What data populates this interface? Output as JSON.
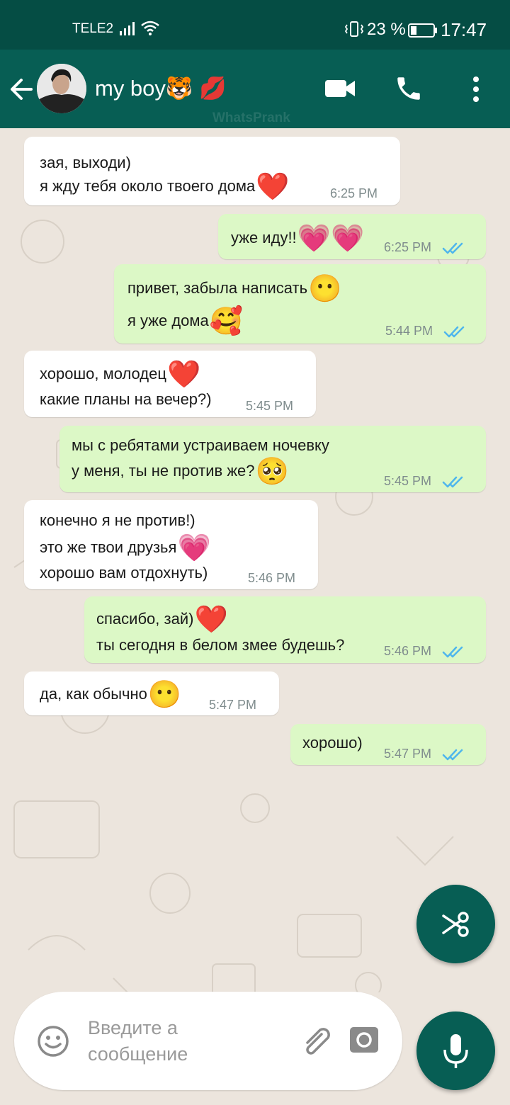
{
  "status_bar": {
    "carrier": "TELE2",
    "battery": "23 %",
    "time": "17:47"
  },
  "header": {
    "contact_name": "my boy🐯 💋",
    "watermark": "WhatsPrank"
  },
  "messages": [
    {
      "dir": "in",
      "lines": [
        "зая, выходи)",
        "я жду тебя около твоего дома"
      ],
      "emoji": [
        "",
        "❤️"
      ],
      "time": "6:25 PM"
    },
    {
      "dir": "out",
      "lines": [
        "уже иду!!"
      ],
      "emoji": [
        "💗💗"
      ],
      "time": "6:25 PM"
    },
    {
      "dir": "out",
      "lines": [
        "привет, забыла написать",
        "я уже дома"
      ],
      "emoji": [
        "😶",
        "🥰"
      ],
      "time": "5:44 PM"
    },
    {
      "dir": "in",
      "lines": [
        "хорошо, молодец",
        "какие планы на вечер?)"
      ],
      "emoji": [
        "❤️",
        ""
      ],
      "time": "5:45 PM"
    },
    {
      "dir": "out",
      "lines": [
        "мы с ребятами устраиваем ночевку",
        "у меня, ты не против же?"
      ],
      "emoji": [
        "",
        "🥺"
      ],
      "time": "5:45 PM"
    },
    {
      "dir": "in",
      "lines": [
        "конечно я не против!)",
        "это же твои друзья",
        "хорошо вам отдохнуть)"
      ],
      "emoji": [
        "",
        "💗",
        ""
      ],
      "time": "5:46 PM"
    },
    {
      "dir": "out",
      "lines": [
        "спасибо, зай)",
        "ты сегодня в белом змее будешь?"
      ],
      "emoji": [
        "❤️",
        ""
      ],
      "time": "5:46 PM"
    },
    {
      "dir": "in",
      "lines": [
        "да, как обычно"
      ],
      "emoji": [
        "😶"
      ],
      "time": "5:47 PM"
    },
    {
      "dir": "out",
      "lines": [
        "хорошо)"
      ],
      "emoji": [
        ""
      ],
      "time": "5:47 PM"
    }
  ],
  "input": {
    "placeholder": "Введите а сообщение"
  },
  "icons": {
    "back": "arrow-left-icon",
    "video": "video-camera-icon",
    "call": "phone-icon",
    "menu": "more-vertical-icon",
    "scissor": "scissors-icon",
    "emoji": "smiley-icon",
    "attach": "paperclip-icon",
    "camera": "camera-icon",
    "mic": "microphone-icon",
    "read": "double-check-icon"
  },
  "colors": {
    "header": "#075e54",
    "status_bar": "#054d44",
    "outgoing_bubble": "#dcf8c6",
    "incoming_bubble": "#ffffff",
    "chat_background": "#ece5dd",
    "read_tick": "#4fb6ec"
  }
}
